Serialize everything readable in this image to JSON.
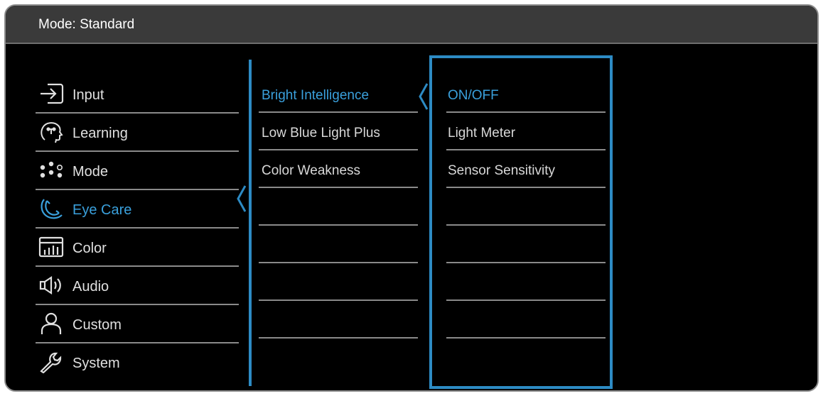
{
  "header": {
    "title": "Mode: Standard"
  },
  "colors": {
    "accent": "#3aa0dc",
    "frame": "#2d8bc4",
    "text": "#e0e0e0",
    "background": "#000000"
  },
  "menu": {
    "items": [
      {
        "label": "Input",
        "icon": "input-icon",
        "active": false
      },
      {
        "label": "Learning",
        "icon": "learning-icon",
        "active": false
      },
      {
        "label": "Mode",
        "icon": "mode-icon",
        "active": false
      },
      {
        "label": "Eye Care",
        "icon": "eye-care-icon",
        "active": true
      },
      {
        "label": "Color",
        "icon": "color-icon",
        "active": false
      },
      {
        "label": "Audio",
        "icon": "audio-icon",
        "active": false
      },
      {
        "label": "Custom",
        "icon": "custom-icon",
        "active": false
      },
      {
        "label": "System",
        "icon": "system-icon",
        "active": false
      }
    ]
  },
  "submenu": {
    "items": [
      {
        "label": "Bright Intelligence",
        "active": true
      },
      {
        "label": "Low Blue Light Plus",
        "active": false
      },
      {
        "label": "Color Weakness",
        "active": false
      },
      {
        "label": ""
      },
      {
        "label": ""
      },
      {
        "label": ""
      },
      {
        "label": ""
      },
      {
        "label": ""
      }
    ]
  },
  "options": {
    "items": [
      {
        "label": "ON/OFF",
        "active": true
      },
      {
        "label": "Light Meter",
        "active": false
      },
      {
        "label": "Sensor Sensitivity",
        "active": false
      },
      {
        "label": ""
      },
      {
        "label": ""
      },
      {
        "label": ""
      },
      {
        "label": ""
      },
      {
        "label": ""
      }
    ]
  }
}
